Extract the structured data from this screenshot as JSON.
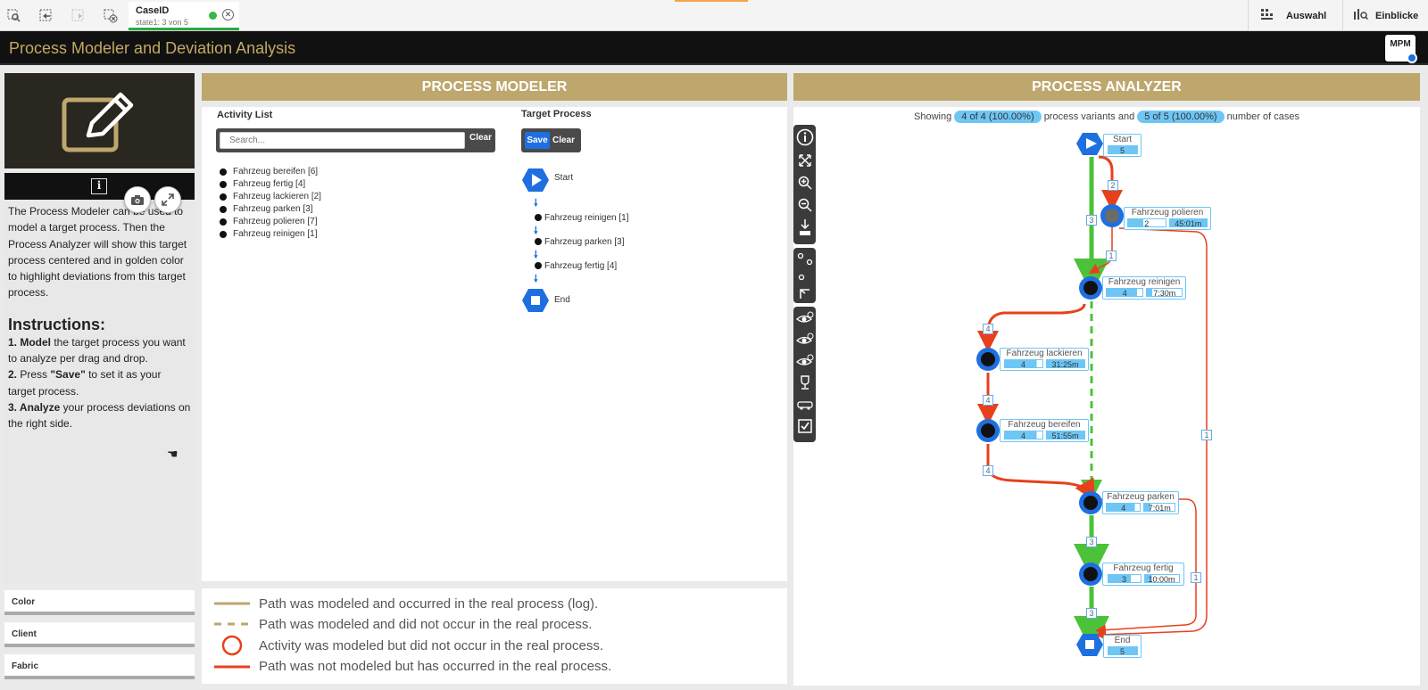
{
  "toolbar": {
    "selection_field": "CaseID",
    "selection_state": "state1: 3 von 5",
    "right_buttons": [
      "Auswahl",
      "Einblicke"
    ]
  },
  "app": {
    "title": "Process Modeler and Deviation Analysis",
    "badge": "MPM"
  },
  "left": {
    "description": "The Process Modeler can be used to model a target process. Then the Process Analyzer will show this target process centered and in golden color to highlight deviations from this target process.",
    "instructions_title": "Instructions:",
    "instructions": [
      {
        "bold": "Model",
        "rest": " the target process you want to analyze per drag and drop.",
        "num": "1. "
      },
      {
        "bold": "\"Save\"",
        "pre": "Press ",
        "rest": " to set it as your target process.",
        "num": "2. "
      },
      {
        "bold": "Analyze",
        "rest": " your process deviations on the right side.",
        "num": "3. "
      }
    ],
    "filters": [
      "Color",
      "Client",
      "Fabric"
    ]
  },
  "modeler": {
    "header": "PROCESS MODELER",
    "activity_list_label": "Activity List",
    "search_placeholder": "Search...",
    "clear_label": "Clear",
    "activities": [
      "Fahrzeug bereifen [6]",
      "Fahrzeug fertig [4]",
      "Fahrzeug lackieren [2]",
      "Fahrzeug parken [3]",
      "Fahrzeug polieren [7]",
      "Fahrzeug reinigen [1]"
    ],
    "target_label": "Target Process",
    "save_label": "Save",
    "target_clear_label": "Clear",
    "start_label": "Start",
    "end_label": "End",
    "target_steps": [
      "Fahrzeug reinigen [1]",
      "Fahrzeug parken [3]",
      "Fahrzeug fertig [4]"
    ]
  },
  "legend": [
    "Path was modeled and occurred in the real process (log).",
    "Path was modeled and did not occur in the real process.",
    "Activity was modeled but did not occur in the real process.",
    "Path was not modeled but has occurred in the real process."
  ],
  "analyzer": {
    "header": "PROCESS ANALYZER",
    "showing_prefix": "Showing",
    "variants_pill": "4 of 4 (100.00%)",
    "variants_text": "process variants and",
    "cases_pill": "5 of 5 (100.00%)",
    "cases_text": "number of cases",
    "nodes": {
      "start": {
        "name": "Start",
        "count": "5"
      },
      "polieren": {
        "name": "Fahrzeug polieren",
        "count": "2",
        "time": "45:01m"
      },
      "reinigen": {
        "name": "Fahrzeug reinigen",
        "count": "4",
        "time": "7:30m"
      },
      "lackieren": {
        "name": "Fahrzeug lackieren",
        "count": "4",
        "time": "31:25m"
      },
      "bereifen": {
        "name": "Fahrzeug bereifen",
        "count": "4",
        "time": "51:55m"
      },
      "parken": {
        "name": "Fahrzeug parken",
        "count": "4",
        "time": "7:01m"
      },
      "fertig": {
        "name": "Fahrzeug fertig",
        "count": "3",
        "time": "10:00m"
      },
      "end": {
        "name": "End",
        "count": "5"
      }
    },
    "edges": {
      "e_start_pol": "2",
      "e_start_rein": "3",
      "e_pol_rein": "1",
      "e_rein_lack": "4",
      "e_lack_ber": "4",
      "e_ber_park": "4",
      "e_park_fert": "3",
      "e_fert_end": "3",
      "e_park_end": "1",
      "e_pol_end": "1"
    },
    "colors": {
      "green": "#4cc23a",
      "red": "#e8401c",
      "gold": "#bea76d",
      "blue": "#1e6fe0"
    }
  }
}
